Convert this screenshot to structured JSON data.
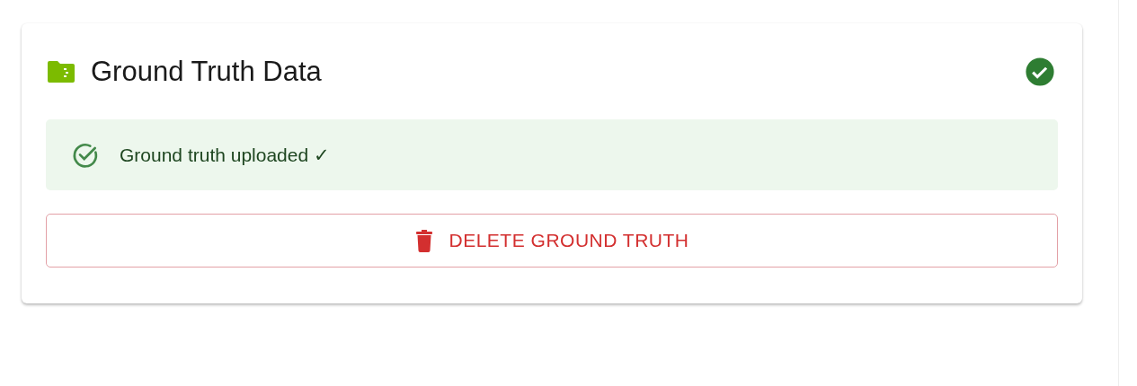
{
  "card": {
    "title": "Ground Truth Data",
    "complete": true,
    "alert": {
      "kind": "success",
      "message": "Ground truth uploaded ✓"
    },
    "button": {
      "label": "DELETE GROUND TRUTH"
    }
  }
}
